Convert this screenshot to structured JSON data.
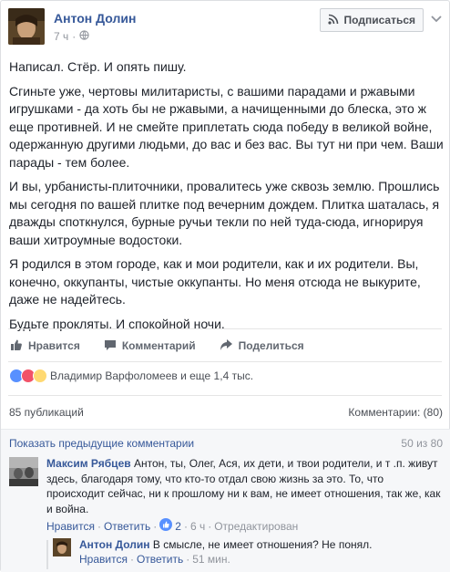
{
  "post": {
    "author": "Антон Долин",
    "time": "7 ч",
    "follow_label": "Подписаться",
    "paragraphs": [
      "Написал. Стёр. И опять пишу.",
      "Сгиньте уже, чертовы милитаристы, с вашими парадами и ржавыми игрушками - да хоть бы не ржавыми, а начищенными до блеска, это ж еще противней. И не смейте приплетать сюда победу в великой войне, одержанную другими людьми, до вас и без вас. Вы тут ни при чем. Ваши парады - тем более.",
      "И вы, урбанисты-плиточники, провалитесь уже сквозь землю. Прошлись мы сегодня по вашей плитке под вечерним дождем. Плитка шаталась, я дважды споткнулся, бурные ручьи текли по ней туда-сюда, игнорируя ваши хитроумные водостоки.",
      "Я родился в этом городе, как и мои родители, как и их родители. Вы, конечно, оккупанты, чистые оккупанты. Но меня отсюда не выкурите, даже не надейтесь.",
      "Будьте прокляты. И спокойной ночи."
    ]
  },
  "actions": {
    "like": "Нравится",
    "comment": "Комментарий",
    "share": "Поделиться"
  },
  "reactions": {
    "summary": "Владимир Варфоломеев и еще 1,4 тыс."
  },
  "counts": {
    "shares": "85 публикаций",
    "comments": "Комментарии: (80)"
  },
  "comments": {
    "show_previous": "Показать предыдущие комментарии",
    "range": "50 из 80",
    "first": {
      "author": "Максим Рябцев",
      "text": "Антон, ты, Олег, Ася, их дети, и твои родители, и т .п. живут здесь, благодаря тому, что кто-то отдал свою жизнь за это. То, что происходит сейчас, ни к прошлому ни к вам, не имеет отношения, так же, как и война.",
      "like": "Нравится",
      "reply": "Ответить",
      "like_count": "2",
      "time": "6 ч",
      "edited": "Отредактирован"
    },
    "reply": {
      "author": "Антон Долин",
      "text": "В смысле, не имеет отношения? Не понял.",
      "like": "Нравится",
      "reply": "Ответить",
      "time": "51 мин."
    }
  },
  "colors": {
    "link": "#365899",
    "muted": "#90949c",
    "like_blue": "#5890ff",
    "love_red": "#f25268",
    "sad_yellow": "#ffd972"
  }
}
